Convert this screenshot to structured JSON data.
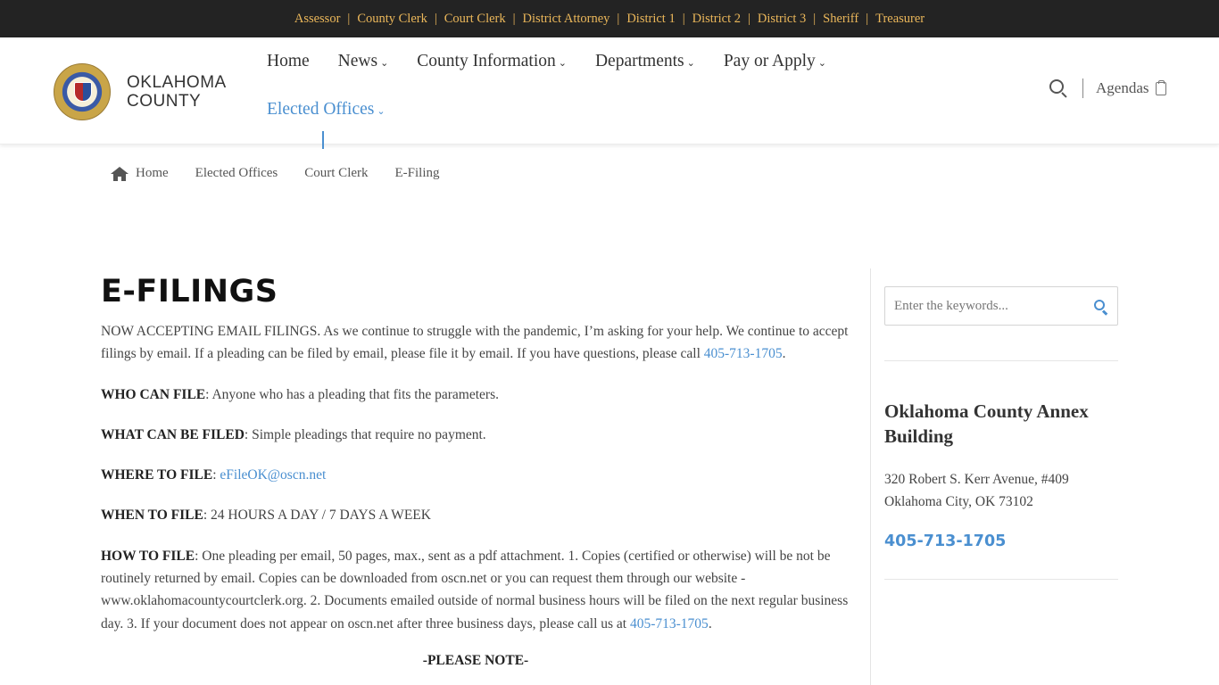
{
  "topbar": {
    "links": [
      "Assessor",
      "County Clerk",
      "Court Clerk",
      "District Attorney",
      "District 1",
      "District 2",
      "District 3",
      "Sheriff",
      "Treasurer"
    ],
    "separator": "|"
  },
  "header": {
    "logo_line1": "OKLAHOMA",
    "logo_line2": "COUNTY",
    "nav": {
      "home": "Home",
      "news": "News",
      "county_information": "County Information",
      "departments": "Departments",
      "pay_or_apply": "Pay or Apply",
      "elected_offices": "Elected Offices"
    },
    "agendas": "Agendas"
  },
  "breadcrumb": {
    "home": "Home",
    "elected_offices": "Elected Offices",
    "court_clerk": "Court Clerk",
    "current": "E-Filing"
  },
  "main": {
    "title": "E-FILINGS",
    "intro_text": "NOW ACCEPTING EMAIL FILINGS. As we continue to struggle with the pandemic, I’m asking for your help. We continue to accept filings by email. If a pleading can be filed by email, please file it by email. If you have questions, please call ",
    "intro_phone": "405-713-1705",
    "who_label": "WHO CAN FILE",
    "who_text": ": Anyone who has a pleading that fits the parameters.",
    "what_label": "WHAT CAN BE FILED",
    "what_text": ": Simple pleadings that require no payment.",
    "where_label": "WHERE TO FILE",
    "where_colon": ": ",
    "where_email": "eFileOK@oscn.net",
    "when_label": "WHEN TO FILE",
    "when_text": ": 24 HOURS A DAY / 7 DAYS A WEEK",
    "how_label": "HOW TO FILE",
    "how_text": ": One pleading per email, 50 pages, max., sent as a pdf attachment. 1. Copies (certified or otherwise) will be not be routinely returned by email. Copies can be downloaded from oscn.net or you can request them through our website - www.oklahomacountycourtclerk.org. 2. Documents emailed outside of normal business hours will be filed on the next regular business day. 3. If your document does not appear on oscn.net after three business days, please call us at ",
    "how_phone": "405-713-1705",
    "please_note": "-PLEASE NOTE-"
  },
  "sidebar": {
    "search_placeholder": "Enter the keywords...",
    "annex_title": "Oklahoma County Annex Building",
    "address_line1": "320 Robert S. Kerr Avenue, #409",
    "address_line2": "Oklahoma City, OK 73102",
    "phone": "405-713-1705"
  },
  "colors": {
    "topbar_bg": "#232323",
    "topbar_text": "#ebb75a",
    "link": "#4a8fd0",
    "title": "#111111"
  }
}
